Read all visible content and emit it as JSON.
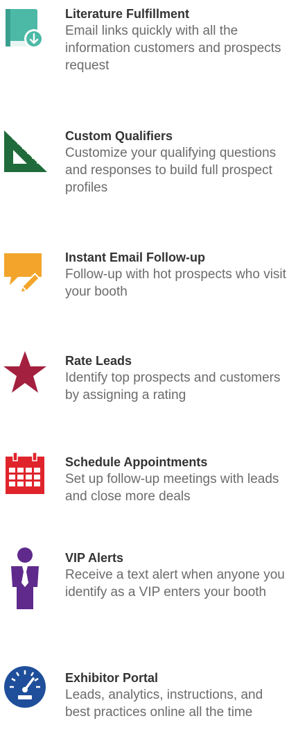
{
  "features": [
    {
      "icon": "book-download-icon",
      "title": "Literature Fulfillment",
      "description": "Email links quickly with all the information customers and prospects request",
      "color": "#4cb9a6"
    },
    {
      "icon": "triangle-ruler-icon",
      "title": "Custom Qualifiers",
      "description": "Customize your qualifying questions and responses to build full prospect profiles",
      "color": "#1f6b3b"
    },
    {
      "icon": "chat-pencil-icon",
      "title": "Instant Email Follow-up",
      "description": "Follow-up with hot prospects who visit your booth",
      "color": "#f2a52a"
    },
    {
      "icon": "star-icon",
      "title": "Rate Leads",
      "description": "Identify top prospects and customers by assigning a rating",
      "color": "#a3203f"
    },
    {
      "icon": "calendar-icon",
      "title": "Schedule Appointments",
      "description": "Set up follow-up meetings with leads and close more deals",
      "color": "#e0242c"
    },
    {
      "icon": "vip-person-icon",
      "title": "VIP Alerts",
      "description": "Receive a text alert when anyone you identify as a VIP enters your booth",
      "color": "#5f2a8c"
    },
    {
      "icon": "speedometer-icon",
      "title": "Exhibitor Portal",
      "description": "Leads, analytics, instructions, and best practices online all the time",
      "color": "#1f4f9a"
    }
  ]
}
